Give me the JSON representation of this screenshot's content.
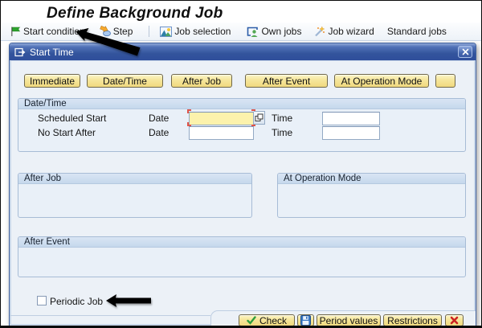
{
  "page_title": "Define Background Job",
  "toolbar": {
    "items": [
      {
        "label": "Start condition",
        "icon": "flag-icon"
      },
      {
        "label": "Step",
        "icon": "step-icon"
      },
      {
        "label": "Job selection",
        "icon": "job-selection-icon"
      },
      {
        "label": "Own jobs",
        "icon": "own-jobs-icon"
      },
      {
        "label": "Job wizard",
        "icon": "job-wizard-icon"
      },
      {
        "label": "Standard jobs",
        "icon": ""
      }
    ]
  },
  "dialog": {
    "title": "Start Time",
    "start_type_buttons": [
      {
        "label": "Immediate"
      },
      {
        "label": "Date/Time"
      },
      {
        "label": "After Job"
      },
      {
        "label": "After Event"
      },
      {
        "label": "At Operation Mode"
      },
      {
        "label": ""
      }
    ],
    "date_time_group": {
      "title": "Date/Time",
      "rows": [
        {
          "label": "Scheduled Start",
          "date_label": "Date",
          "date_value": "",
          "time_label": "Time",
          "time_value": "",
          "focused": true,
          "has_value_help": true
        },
        {
          "label": "No Start After",
          "date_label": "Date",
          "date_value": "",
          "time_label": "Time",
          "time_value": "",
          "focused": false,
          "has_value_help": false
        }
      ]
    },
    "after_job_group": {
      "title": "After Job"
    },
    "at_operation_mode_group": {
      "title": "At Operation Mode"
    },
    "after_event_group": {
      "title": "After Event"
    },
    "periodic_job": {
      "label": "Periodic Job",
      "checked": false
    },
    "footer": {
      "check_label": "Check",
      "period_values_label": "Period values",
      "restrictions_label": "Restrictions"
    }
  },
  "colors": {
    "accent-button-yellow": "#F0D97E",
    "titlebar-blue": "#33549C",
    "focus-corner-red": "#E0554A",
    "flag-green": "#2EA52E",
    "check-green": "#2E9E3E",
    "save-blue": "#3876C2",
    "cancel-red": "#CC2222",
    "annotation-black": "#000000"
  }
}
